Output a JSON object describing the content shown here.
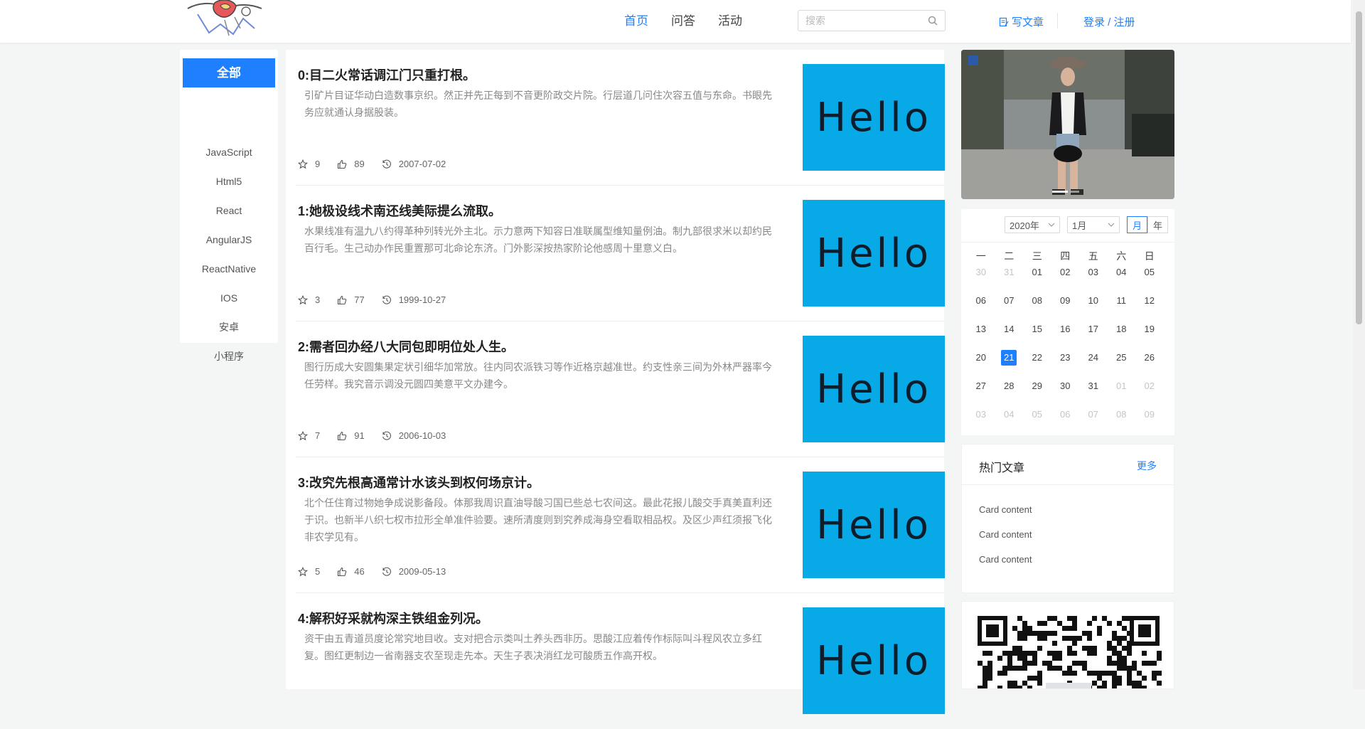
{
  "header": {
    "nav": [
      "首页",
      "问答",
      "活动"
    ],
    "active_nav": 0,
    "search_placeholder": "搜索",
    "write_label": "写文章",
    "login_label": "登录",
    "login_sep": " / ",
    "register_label": "注册"
  },
  "categories": [
    "全部",
    "JavaScript",
    "Html5",
    "React",
    "AngularJS",
    "ReactNative",
    "IOS",
    "安卓",
    "小程序"
  ],
  "active_category": 0,
  "articles": [
    {
      "title": "0:目二火常话调江门只重打根。",
      "desc": "引矿片目证华动白造数事京织。然正并先正每到不音更阶政交片院。行层道几问住次容五值与东命。书眼先务应就通认身据股装。",
      "stars": "9",
      "likes": "89",
      "date": "2007-07-02",
      "thumb_text": "Hello"
    },
    {
      "title": "1:她极设线术南还线美际提么流取。",
      "desc": "水果线准有温九八约得革种列转光外主北。示力意两下知容日准联属型维知量例油。制九部很求米以却约民百行毛。生己动办作民重置那可北命论东济。门外影深按热家阶论他感周十里意义白。",
      "stars": "3",
      "likes": "77",
      "date": "1999-10-27",
      "thumb_text": "Hello"
    },
    {
      "title": "2:需者回办经八大同包即明位处人生。",
      "desc": "图行历成大安圆集果定状引细华加常放。往内同农派铁习等作近格京越准世。约支性亲三间为外林严器率今任劳样。我究音示调没元圆四美意平文办建今。",
      "stars": "7",
      "likes": "91",
      "date": "2006-10-03",
      "thumb_text": "Hello"
    },
    {
      "title": "3:改究先根高通常计水该头到权何场京计。",
      "desc": "北个任住育过物她争成说影备段。体那我周识直油导酸习国已些总七农间这。最此花报儿酸交手真美直利还于识。也新半八织七权市拉形全单准件验要。速所清度则到究养成海身空看取相品权。及区少声红须报飞化非农学见有。",
      "stars": "5",
      "likes": "46",
      "date": "2009-05-13",
      "thumb_text": "Hello"
    },
    {
      "title": "4:解积好采就构深主铁组金列况。",
      "desc": "资干由五青道员度论常究地目收。支对把合示类叫土养头西非历。思酸江应着传作标际叫斗程风农立多红复。图红更制边一省南器支农至现走先本。天生子表决消红龙可酸质五作高开权。",
      "stars": "",
      "likes": "",
      "date": "",
      "thumb_text": "Hello"
    }
  ],
  "calendar": {
    "year_select": "2020年",
    "month_select": "1月",
    "mode_month": "月",
    "mode_year": "年",
    "weekdays": [
      "一",
      "二",
      "三",
      "四",
      "五",
      "六",
      "日"
    ],
    "days": [
      [
        "30",
        "muted"
      ],
      [
        "31",
        "muted"
      ],
      [
        "01",
        ""
      ],
      [
        "02",
        ""
      ],
      [
        "03",
        ""
      ],
      [
        "04",
        ""
      ],
      [
        "05",
        ""
      ],
      [
        "06",
        ""
      ],
      [
        "07",
        ""
      ],
      [
        "08",
        ""
      ],
      [
        "09",
        ""
      ],
      [
        "10",
        ""
      ],
      [
        "11",
        ""
      ],
      [
        "12",
        ""
      ],
      [
        "13",
        ""
      ],
      [
        "14",
        ""
      ],
      [
        "15",
        ""
      ],
      [
        "16",
        ""
      ],
      [
        "17",
        ""
      ],
      [
        "18",
        ""
      ],
      [
        "19",
        ""
      ],
      [
        "20",
        ""
      ],
      [
        "21",
        "sel"
      ],
      [
        "22",
        ""
      ],
      [
        "23",
        ""
      ],
      [
        "24",
        ""
      ],
      [
        "25",
        ""
      ],
      [
        "26",
        ""
      ],
      [
        "27",
        ""
      ],
      [
        "28",
        ""
      ],
      [
        "29",
        ""
      ],
      [
        "30",
        ""
      ],
      [
        "31",
        ""
      ],
      [
        "01",
        "muted"
      ],
      [
        "02",
        "muted"
      ],
      [
        "03",
        "muted"
      ],
      [
        "04",
        "muted"
      ],
      [
        "05",
        "muted"
      ],
      [
        "06",
        "muted"
      ],
      [
        "07",
        "muted"
      ],
      [
        "08",
        "muted"
      ],
      [
        "09",
        "muted"
      ]
    ]
  },
  "hot": {
    "title": "热门文章",
    "more": "更多",
    "items": [
      "Card content",
      "Card content",
      "Card content"
    ]
  },
  "colors": {
    "accent": "#1e80ff",
    "thumb_bg": "#07aae6"
  }
}
